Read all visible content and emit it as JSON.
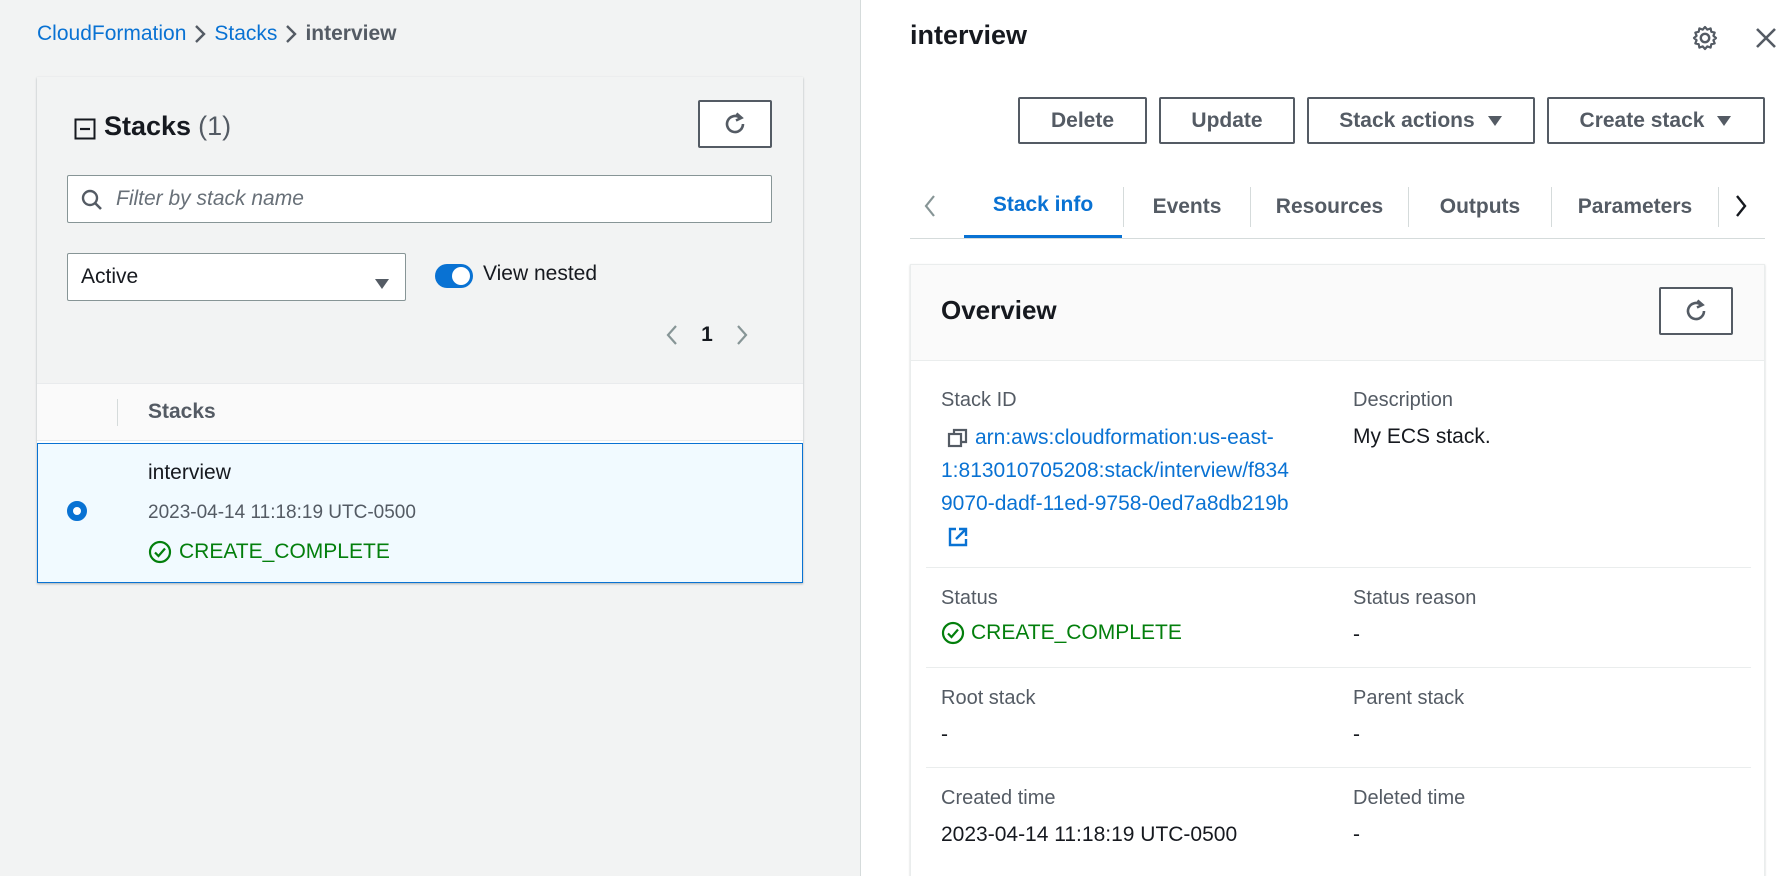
{
  "breadcrumb": {
    "items": [
      "CloudFormation",
      "Stacks"
    ],
    "current": "interview"
  },
  "stacks_panel": {
    "title": "Stacks",
    "count": "(1)",
    "search_placeholder": "Filter by stack name",
    "filter_selected": "Active",
    "view_nested_label": "View nested",
    "view_nested_on": true,
    "page": "1",
    "column_header": "Stacks",
    "rows": [
      {
        "name": "interview",
        "created": "2023-04-14 11:18:19 UTC-0500",
        "status": "CREATE_COMPLETE",
        "selected": true
      }
    ]
  },
  "detail": {
    "title": "interview",
    "buttons": {
      "delete": "Delete",
      "update": "Update",
      "stack_actions": "Stack actions",
      "create_stack": "Create stack"
    },
    "tabs": [
      "Stack info",
      "Events",
      "Resources",
      "Outputs",
      "Parameters"
    ],
    "active_tab": "Stack info",
    "overview": {
      "title": "Overview",
      "stack_id_label": "Stack ID",
      "stack_id_lines": [
        "arn:aws:cloudformation:us-east-",
        "1:813010705208:stack/interview/f834",
        "9070-dadf-11ed-9758-0ed7a8db219b"
      ],
      "description_label": "Description",
      "description": "My ECS stack.",
      "status_label": "Status",
      "status": "CREATE_COMPLETE",
      "status_reason_label": "Status reason",
      "status_reason": "-",
      "root_stack_label": "Root stack",
      "root_stack": "-",
      "parent_stack_label": "Parent stack",
      "parent_stack": "-",
      "created_time_label": "Created time",
      "created_time": "2023-04-14 11:18:19 UTC-0500",
      "deleted_time_label": "Deleted time",
      "deleted_time": "-"
    }
  },
  "colors": {
    "link": "#0972d3",
    "success": "#037f0c",
    "text": "#16191f",
    "muted": "#545b64",
    "selected_row_bg": "#f1faff"
  }
}
